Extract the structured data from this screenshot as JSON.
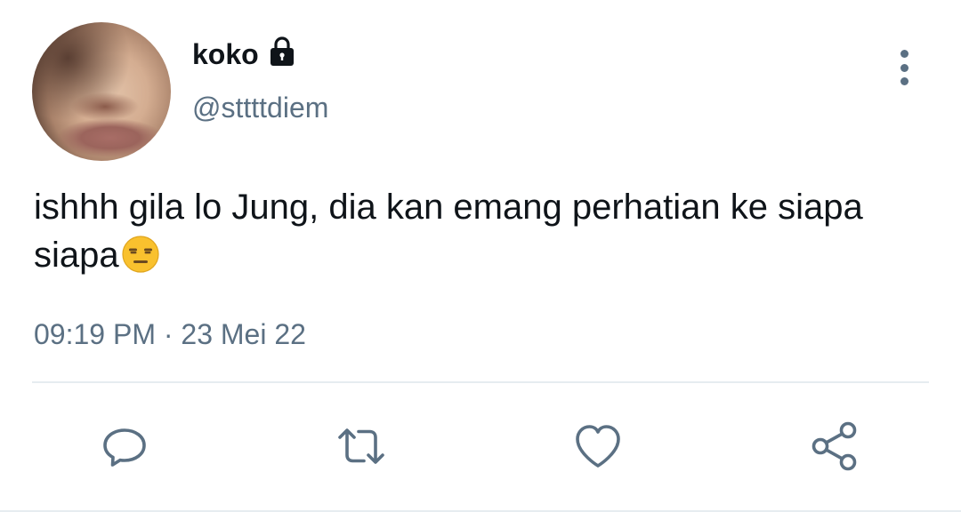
{
  "author": {
    "display_name": "koko",
    "handle": "@sttttdiem",
    "protected_icon": "lock-icon"
  },
  "tweet": {
    "text": "ishhh gila lo Jung, dia kan emang perhatian ke siapa siapa",
    "emoji": "expressionless-face-emoji",
    "time": "09:19 PM",
    "separator": "·",
    "date": "23 Mei 22"
  },
  "actions": [
    {
      "name": "reply",
      "icon": "comment-icon"
    },
    {
      "name": "retweet",
      "icon": "retweet-icon"
    },
    {
      "name": "like",
      "icon": "heart-icon"
    },
    {
      "name": "share",
      "icon": "share-icon"
    }
  ],
  "colors": {
    "text_primary": "#0f1419",
    "text_secondary": "#5b7083",
    "divider": "#e6ecf0",
    "emoji_yellow": "#f9c12e"
  }
}
